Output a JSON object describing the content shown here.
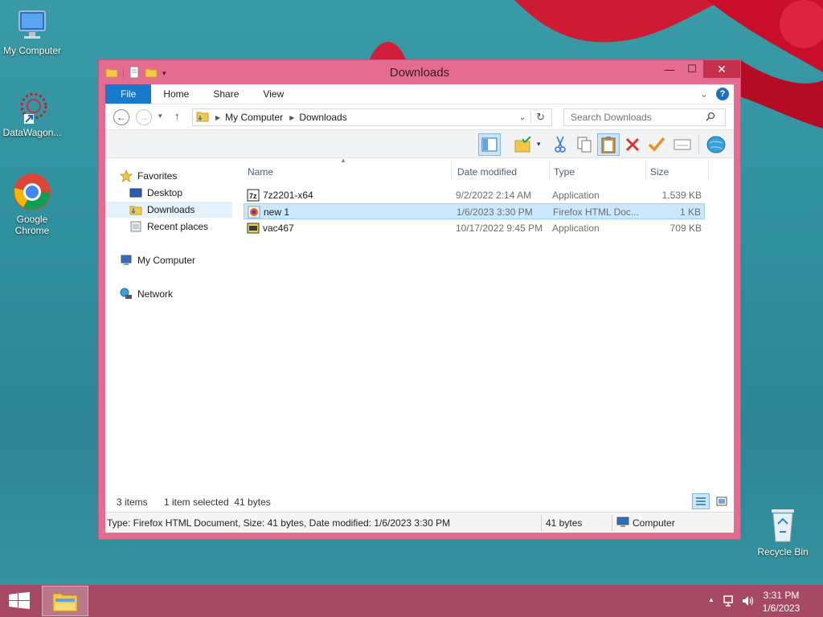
{
  "desktop": {
    "icons": [
      {
        "label": "My Computer"
      },
      {
        "label": "DataWagon..."
      },
      {
        "label": "Google Chrome"
      },
      {
        "label": "Recycle Bin"
      }
    ]
  },
  "window": {
    "title": "Downloads",
    "controls": {
      "minimize": "—",
      "maximize": "☐",
      "close": "✕"
    }
  },
  "ribbon": {
    "tabs": [
      "File",
      "Home",
      "Share",
      "View"
    ],
    "expand": "⌄",
    "help": "?"
  },
  "address": {
    "crumbs": [
      "My Computer",
      "Downloads"
    ],
    "search_placeholder": "Search Downloads"
  },
  "navpane": {
    "favorites": "Favorites",
    "items": [
      "Desktop",
      "Downloads",
      "Recent places"
    ],
    "computer": "My Computer",
    "network": "Network"
  },
  "columns": {
    "name": "Name",
    "date": "Date modified",
    "type": "Type",
    "size": "Size"
  },
  "files": [
    {
      "name": "7z2201-x64",
      "date": "9/2/2022 2:14 AM",
      "type": "Application",
      "size": "1,539 KB"
    },
    {
      "name": "new 1",
      "date": "1/6/2023 3:30 PM",
      "type": "Firefox HTML Doc...",
      "size": "1 KB"
    },
    {
      "name": "vac467",
      "date": "10/17/2022 9:45 PM",
      "type": "Application",
      "size": "709 KB"
    }
  ],
  "counts": {
    "items": "3 items",
    "selected": "1 item selected  41 bytes"
  },
  "statusbar": {
    "details": "Type: Firefox HTML Document, Size: 41 bytes, Date modified: 1/6/2023 3:30 PM",
    "size": "41 bytes",
    "location": "Computer"
  },
  "taskbar": {
    "time": "3:31 PM",
    "date": "1/6/2023"
  },
  "colors": {
    "window_frame": "#e46c91",
    "file_tab": "#1979ca",
    "selection": "#cce8ff",
    "taskbar": "#a64a63"
  }
}
